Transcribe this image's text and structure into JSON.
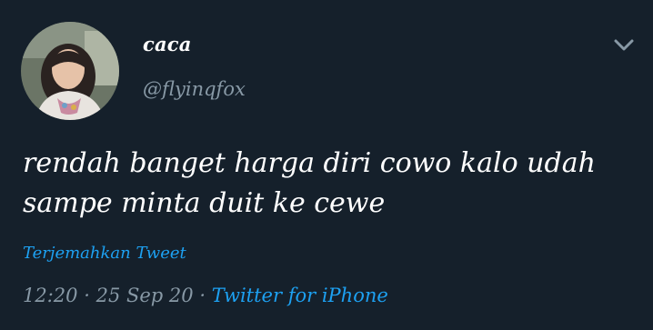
{
  "user": {
    "display_name": "caca",
    "handle": "@flyinqfox"
  },
  "tweet": {
    "text_lines": [
      "rendah banget harga diri cowo kalo udah",
      "sampe minta duit ke cewe"
    ],
    "translate_label": "Terjemahkan Tweet",
    "time": "12:20",
    "separator": "·",
    "date": "25 Sep 20",
    "source": "Twitter for iPhone"
  },
  "icons": {
    "menu": "chevron-down-icon",
    "avatar": "avatar-photo"
  },
  "colors": {
    "background": "#15202b",
    "text": "#ffffff",
    "secondary": "#8899a6",
    "accent": "#1da1f2"
  }
}
